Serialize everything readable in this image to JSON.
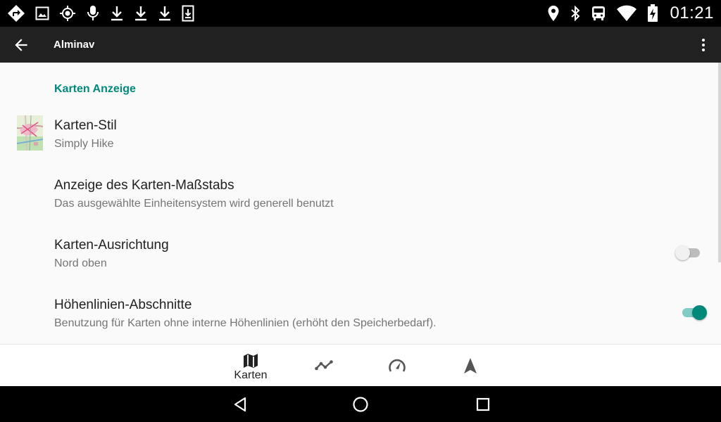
{
  "status_bar": {
    "clock": "01:21",
    "left_icons": [
      "directions-icon",
      "image-icon",
      "gps-icon",
      "mic-icon",
      "download-icon",
      "download-icon",
      "download-icon",
      "sd-download-icon"
    ],
    "right_icons": [
      "location-icon",
      "bluetooth-icon",
      "bus-icon",
      "wifi-icon",
      "battery-charging-icon"
    ]
  },
  "app_bar": {
    "title": "Alminav"
  },
  "settings": {
    "section_header": "Karten Anzeige",
    "items": [
      {
        "title": "Karten-Stil",
        "summary": "Simply Hike",
        "icon": "map-style-thumbnail"
      },
      {
        "title": "Anzeige des Karten-Maßstabs",
        "summary": "Das ausgewählte Einheitensystem wird generell benutzt"
      },
      {
        "title": "Karten-Ausrichtung",
        "summary": "Nord oben",
        "switch_on": false
      },
      {
        "title": "Höhenlinien-Abschnitte",
        "summary": "Benutzung für Karten ohne interne Höhenlinien (erhöht den Speicherbedarf).",
        "switch_on": true
      }
    ]
  },
  "bottom_nav": {
    "items": [
      {
        "label": "Karten",
        "icon": "map-icon",
        "selected": true
      },
      {
        "label": "",
        "icon": "track-icon",
        "selected": false
      },
      {
        "label": "",
        "icon": "speedometer-icon",
        "selected": false
      },
      {
        "label": "",
        "icon": "navigation-arrow-icon",
        "selected": false
      }
    ]
  },
  "colors": {
    "accent": "#00897b",
    "app_bar": "#212121",
    "background": "#fafafa"
  }
}
